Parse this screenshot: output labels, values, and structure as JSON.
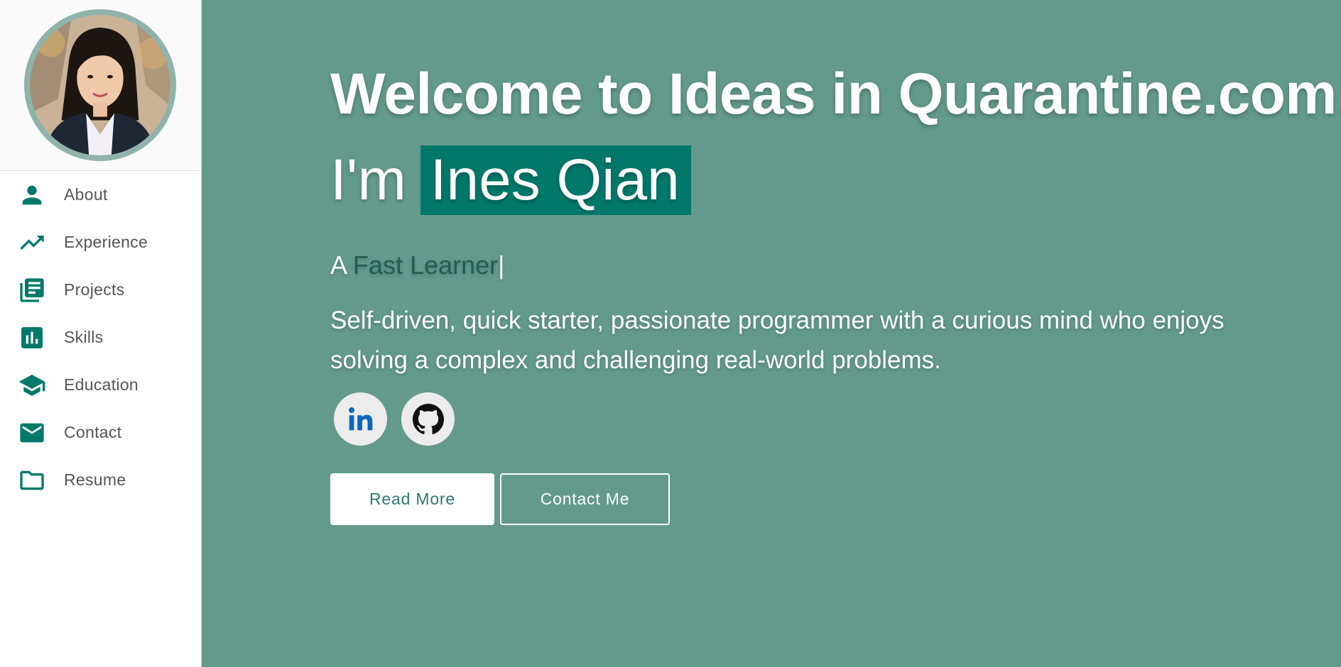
{
  "sidebar": {
    "nav": [
      {
        "label": "About",
        "icon": "person-icon"
      },
      {
        "label": "Experience",
        "icon": "trending-up-icon"
      },
      {
        "label": "Projects",
        "icon": "library-books-icon"
      },
      {
        "label": "Skills",
        "icon": "bar-chart-icon"
      },
      {
        "label": "Education",
        "icon": "graduation-cap-icon"
      },
      {
        "label": "Contact",
        "icon": "mail-icon"
      },
      {
        "label": "Resume",
        "icon": "folder-icon"
      }
    ]
  },
  "hero": {
    "headline": "Welcome to Ideas in Quarantine.com!",
    "name_prefix": "I'm",
    "name": "Ines Qian",
    "typer_prefix": "A",
    "typer_text": "Fast Learner",
    "cursor": "|",
    "description": "Self-driven, quick starter, passionate programmer with a curious mind who enjoys solving a complex and challenging real-world problems.",
    "buttons": {
      "read_more": "Read More",
      "contact_me": "Contact Me"
    }
  },
  "colors": {
    "accent": "#00796b",
    "background": "#639a8c"
  }
}
